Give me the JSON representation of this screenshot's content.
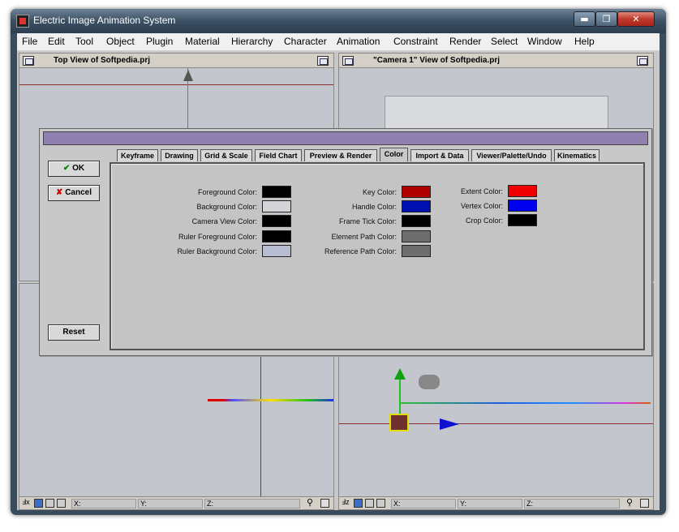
{
  "window": {
    "title": "Electric Image Animation System",
    "min": "▬",
    "max": "❐",
    "close": "✕"
  },
  "menu": [
    "File",
    "Edit",
    "Tool",
    "Object",
    "Plugin",
    "Material",
    "Hierarchy",
    "Character",
    "Animation",
    "Constraint",
    "Render",
    "Select",
    "Window",
    "Help"
  ],
  "viewports": {
    "top_left": {
      "title": "Top View of Softpedia.prj"
    },
    "top_right": {
      "title": "\"Camera 1\" View of Softpedia.prj"
    }
  },
  "status": {
    "x": "X:",
    "y": "Y:",
    "z": "Z:"
  },
  "dialog": {
    "ok": "OK",
    "cancel": "Cancel",
    "reset": "Reset",
    "tabs": [
      "Keyframe",
      "Drawing",
      "Grid & Scale",
      "Field Chart",
      "Preview & Render",
      "Color",
      "Import & Data",
      "Viewer/Palette/Undo",
      "Kinematics"
    ],
    "active_tab": "Color",
    "colors_left": [
      {
        "label": "Foreground Color:",
        "hex": "#000000"
      },
      {
        "label": "Background Color:",
        "hex": "#d4d4d8"
      },
      {
        "label": "Camera View Color:",
        "hex": "#000000"
      },
      {
        "label": "Ruler Foreground Color:",
        "hex": "#000000"
      },
      {
        "label": "Ruler Background Color:",
        "hex": "#b8bcd0"
      }
    ],
    "colors_mid": [
      {
        "label": "Key Color:",
        "hex": "#b00000"
      },
      {
        "label": "Handle Color:",
        "hex": "#0010b0"
      },
      {
        "label": "Frame Tick Color:",
        "hex": "#000000"
      },
      {
        "label": "Element Path Color:",
        "hex": "#6e6e6e"
      },
      {
        "label": "Reference Path Color:",
        "hex": "#6e6e6e"
      }
    ],
    "colors_right": [
      {
        "label": "Extent Color:",
        "hex": "#f00000"
      },
      {
        "label": "Vertex Color:",
        "hex": "#0000f0"
      },
      {
        "label": "Crop Color:",
        "hex": "#000000"
      }
    ]
  }
}
